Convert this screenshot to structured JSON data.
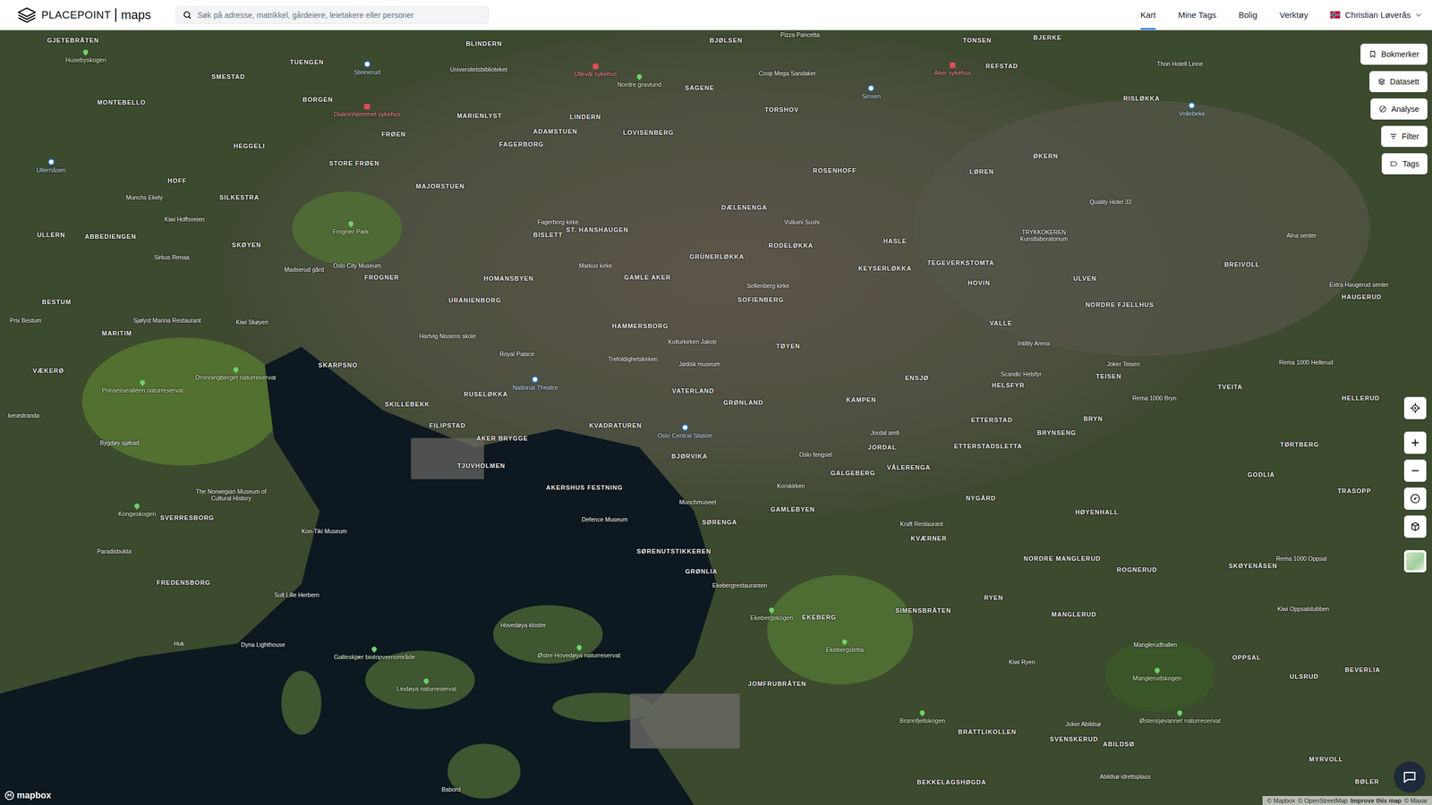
{
  "app": {
    "brand": "PLACEPOINT",
    "product": "maps"
  },
  "search": {
    "placeholder": "Søk på adresse, matrikkel, gårdeiere, leietakere eller personer"
  },
  "nav": [
    {
      "label": "Kart",
      "selected": true
    },
    {
      "label": "Mine Tags",
      "selected": false
    },
    {
      "label": "Bolig",
      "selected": false
    },
    {
      "label": "Verktøy",
      "selected": false
    }
  ],
  "user": {
    "name": "Christian Løverås"
  },
  "map_tools": [
    {
      "label": "Bokmerker"
    },
    {
      "label": "Datasett"
    },
    {
      "label": "Analyse"
    },
    {
      "label": "Filter"
    },
    {
      "label": "Tags"
    }
  ],
  "map": {
    "logo": "mapbox",
    "attribution": [
      {
        "text": "© Mapbox",
        "emphasis": false
      },
      {
        "text": "© OpenStreetMap",
        "emphasis": false
      },
      {
        "text": "Improve this map",
        "emphasis": true
      },
      {
        "text": "© Maxar",
        "emphasis": false
      }
    ],
    "labels": [
      {
        "text": "GJETEBRÅTEN",
        "kind": "area"
      },
      {
        "text": "BLINDERN",
        "kind": "area"
      },
      {
        "text": "Universitetsbiblioteket",
        "kind": "poi"
      },
      {
        "text": "BJØLSEN",
        "kind": "area"
      },
      {
        "text": "Pizza Pancetta",
        "kind": "poi"
      },
      {
        "text": "TONSEN",
        "kind": "area"
      },
      {
        "text": "BJERKE",
        "kind": "area"
      },
      {
        "text": "SMESTAD",
        "kind": "area"
      },
      {
        "text": "TUENGEN",
        "kind": "area"
      },
      {
        "text": "Steinerud",
        "kind": "station"
      },
      {
        "text": "Husebyskogen",
        "kind": "park"
      },
      {
        "text": "MONTEBELLO",
        "kind": "area"
      },
      {
        "text": "BORGEN",
        "kind": "area"
      },
      {
        "text": "Diakonhjemmet sykehus",
        "kind": "hospital"
      },
      {
        "text": "Ullevål sykehus",
        "kind": "hospital"
      },
      {
        "text": "Nordre gravlund",
        "kind": "park"
      },
      {
        "text": "SAGENE",
        "kind": "area"
      },
      {
        "text": "Coop Mega Sandaker",
        "kind": "poi"
      },
      {
        "text": "Aker sykehus",
        "kind": "hospital"
      },
      {
        "text": "REFSTAD",
        "kind": "area"
      },
      {
        "text": "Thon Hotell Linne",
        "kind": "poi"
      },
      {
        "text": "MARIENLYST",
        "kind": "area"
      },
      {
        "text": "ADAMSTUEN",
        "kind": "area"
      },
      {
        "text": "LINDERN",
        "kind": "area"
      },
      {
        "text": "LOVISENBERG",
        "kind": "area"
      },
      {
        "text": "TORSHOV",
        "kind": "area"
      },
      {
        "text": "Sinsen",
        "kind": "station"
      },
      {
        "text": "RISLØKKA",
        "kind": "area"
      },
      {
        "text": "Vollebekk",
        "kind": "station"
      },
      {
        "text": "FRØEN",
        "kind": "area"
      },
      {
        "text": "HEGGELI",
        "kind": "area"
      },
      {
        "text": "FAGERBORG",
        "kind": "area"
      },
      {
        "text": "STORE FRØEN",
        "kind": "area"
      },
      {
        "text": "Ullernåsen",
        "kind": "station"
      },
      {
        "text": "ROSENHOFF",
        "kind": "area"
      },
      {
        "text": "LØREN",
        "kind": "area"
      },
      {
        "text": "ØKERN",
        "kind": "area"
      },
      {
        "text": "HOFF",
        "kind": "area"
      },
      {
        "text": "MAJORSTUEN",
        "kind": "area"
      },
      {
        "text": "Munchs Ekely",
        "kind": "poi"
      },
      {
        "text": "SILKESTRA",
        "kind": "area"
      },
      {
        "text": "DÆLENENGA",
        "kind": "area"
      },
      {
        "text": "Quality Hotel 33",
        "kind": "poi"
      },
      {
        "text": "Kiwi Hoffsveien",
        "kind": "poi"
      },
      {
        "text": "Fagerborg kirke",
        "kind": "poi"
      },
      {
        "text": "Vulkani Sushi",
        "kind": "poi"
      },
      {
        "text": "Frogner Park",
        "kind": "park"
      },
      {
        "text": "ULLERN",
        "kind": "area"
      },
      {
        "text": "ABBEDIENGEN",
        "kind": "area"
      },
      {
        "text": "ST. HANSHAUGEN",
        "kind": "area"
      },
      {
        "text": "BISLETT",
        "kind": "area"
      },
      {
        "text": "HASLE",
        "kind": "area"
      },
      {
        "text": "TRYKKOKEREN Kunstlaboratorium",
        "kind": "poi"
      },
      {
        "text": "Alna senter",
        "kind": "poi"
      },
      {
        "text": "SKØYEN",
        "kind": "area"
      },
      {
        "text": "RODELØKKA",
        "kind": "area"
      },
      {
        "text": "GRÜNERLØKKA",
        "kind": "area"
      },
      {
        "text": "Sirkus Renaa",
        "kind": "poi"
      },
      {
        "text": "Oslo City Museum",
        "kind": "poi"
      },
      {
        "text": "Madserud gård",
        "kind": "poi"
      },
      {
        "text": "Markus kirke",
        "kind": "poi"
      },
      {
        "text": "KEYSERLØKKA",
        "kind": "area"
      },
      {
        "text": "TEGEVERKSTOMTA",
        "kind": "area"
      },
      {
        "text": "BREIVOLL",
        "kind": "area"
      },
      {
        "text": "FROGNER",
        "kind": "area"
      },
      {
        "text": "HOMANSBYEN",
        "kind": "area"
      },
      {
        "text": "GAMLE AKER",
        "kind": "area"
      },
      {
        "text": "ULVEN",
        "kind": "area"
      },
      {
        "text": "HOVIN",
        "kind": "area"
      },
      {
        "text": "Extra Haugerud senter",
        "kind": "poi"
      },
      {
        "text": "Sofienberg kirke",
        "kind": "poi"
      },
      {
        "text": "SOFIENBERG",
        "kind": "area"
      },
      {
        "text": "URANIENBORG",
        "kind": "area"
      },
      {
        "text": "HAUGERUD",
        "kind": "area"
      },
      {
        "text": "BESTUM",
        "kind": "area"
      },
      {
        "text": "NORDRE FJELLHUS",
        "kind": "area"
      },
      {
        "text": "Prix Bestum",
        "kind": "poi"
      },
      {
        "text": "Sjølyst Marina Restaurant",
        "kind": "poi"
      },
      {
        "text": "Kiwi Skøyen",
        "kind": "poi"
      },
      {
        "text": "HAMMERSBORG",
        "kind": "area"
      },
      {
        "text": "VALLE",
        "kind": "area"
      },
      {
        "text": "MARITIM",
        "kind": "area"
      },
      {
        "text": "Hartvig Nissens skole",
        "kind": "poi"
      },
      {
        "text": "Kulturkirken Jakob",
        "kind": "poi"
      },
      {
        "text": "TØYEN",
        "kind": "area"
      },
      {
        "text": "Intility Arena",
        "kind": "poi"
      },
      {
        "text": "Royal Palace",
        "kind": "poi"
      },
      {
        "text": "Trefoldighetskirken",
        "kind": "poi"
      },
      {
        "text": "Jødisk museum",
        "kind": "poi"
      },
      {
        "text": "Rema 1000 Hellerud",
        "kind": "poi"
      },
      {
        "text": "Joker Teisen",
        "kind": "poi"
      },
      {
        "text": "SKARPSNO",
        "kind": "area"
      },
      {
        "text": "VÆKERØ",
        "kind": "area"
      },
      {
        "text": "Dronningberget naturreservat",
        "kind": "park"
      },
      {
        "text": "Scandic Helsfyr",
        "kind": "poi"
      },
      {
        "text": "TEISEN",
        "kind": "area"
      },
      {
        "text": "ENSJØ",
        "kind": "area"
      },
      {
        "text": "Prinsessealléen naturreservat",
        "kind": "park"
      },
      {
        "text": "National Theatre",
        "kind": "station"
      },
      {
        "text": "HELSFYR",
        "kind": "area"
      },
      {
        "text": "TVEITA",
        "kind": "area"
      },
      {
        "text": "VATERLAND",
        "kind": "area"
      },
      {
        "text": "RUSELØKKA",
        "kind": "area"
      },
      {
        "text": "Rema 1000 Bryn",
        "kind": "poi"
      },
      {
        "text": "HELLERUD",
        "kind": "area"
      },
      {
        "text": "KAMPEN",
        "kind": "area"
      },
      {
        "text": "GRØNLAND",
        "kind": "area"
      },
      {
        "text": "SKILLEBEKK",
        "kind": "area"
      },
      {
        "text": "kerøstranda",
        "kind": "poi"
      },
      {
        "text": "BRYN",
        "kind": "area"
      },
      {
        "text": "ETTERSTAD",
        "kind": "area"
      },
      {
        "text": "FILIPSTAD",
        "kind": "area"
      },
      {
        "text": "KVADRATUREN",
        "kind": "area"
      },
      {
        "text": "Oslo Central Station",
        "kind": "station"
      },
      {
        "text": "Jordal amfi",
        "kind": "poi"
      },
      {
        "text": "BRYNSENG",
        "kind": "area"
      },
      {
        "text": "AKER BRYGGE",
        "kind": "area"
      },
      {
        "text": "Bygdøy sjøbad",
        "kind": "poi"
      },
      {
        "text": "TØRTBERG",
        "kind": "area"
      },
      {
        "text": "ETTERSTADSLETTA",
        "kind": "area"
      },
      {
        "text": "JORDAL",
        "kind": "area"
      },
      {
        "text": "Oslo fengsel",
        "kind": "poi"
      },
      {
        "text": "BJØRVIKA",
        "kind": "area"
      },
      {
        "text": "TJUVHOLMEN",
        "kind": "area"
      },
      {
        "text": "VÅLERENGA",
        "kind": "area"
      },
      {
        "text": "GALGEBERG",
        "kind": "area"
      },
      {
        "text": "GODLIA",
        "kind": "area"
      },
      {
        "text": "Korskirken",
        "kind": "poi"
      },
      {
        "text": "AKERSHUS FESTNING",
        "kind": "area"
      },
      {
        "text": "TRASOPP",
        "kind": "area"
      },
      {
        "text": "The Norwegian Museum of Cultural History",
        "kind": "poi"
      },
      {
        "text": "NYGÅRD",
        "kind": "area"
      },
      {
        "text": "Munchmuseet",
        "kind": "poi"
      },
      {
        "text": "GAMLEBYEN",
        "kind": "area"
      },
      {
        "text": "Kongeskogen",
        "kind": "park"
      },
      {
        "text": "HØYENHALL",
        "kind": "area"
      },
      {
        "text": "SVERRESBORG",
        "kind": "area"
      },
      {
        "text": "Defence Museum",
        "kind": "poi"
      },
      {
        "text": "SØRENGA",
        "kind": "area"
      },
      {
        "text": "Kraft Restaurant",
        "kind": "poi"
      },
      {
        "text": "Kon-Tiki Museum",
        "kind": "poi"
      },
      {
        "text": "KVÆRNER",
        "kind": "area"
      },
      {
        "text": "Paradisbukta",
        "kind": "poi"
      },
      {
        "text": "SØRENUTSTIKKEREN",
        "kind": "area"
      },
      {
        "text": "NORDRE MANGLERUD",
        "kind": "area"
      },
      {
        "text": "Rema 1000 Oppsal",
        "kind": "poi"
      },
      {
        "text": "SKØYENÅSEN",
        "kind": "area"
      },
      {
        "text": "ROGNERUD",
        "kind": "area"
      },
      {
        "text": "GRØNLIA",
        "kind": "area"
      },
      {
        "text": "FREDENSBORG",
        "kind": "area"
      },
      {
        "text": "Ekebergrestauranten",
        "kind": "poi"
      },
      {
        "text": "Sult Lille Herbern",
        "kind": "poi"
      },
      {
        "text": "RYEN",
        "kind": "area"
      },
      {
        "text": "SIMENSBRÅTEN",
        "kind": "area"
      },
      {
        "text": "Kiwi Oppsalstubben",
        "kind": "poi"
      },
      {
        "text": "Ekebergskogen",
        "kind": "park"
      },
      {
        "text": "MANGLERUD",
        "kind": "area"
      },
      {
        "text": "EKEBERG",
        "kind": "area"
      },
      {
        "text": "Hovedøya kloster",
        "kind": "poi"
      },
      {
        "text": "Huk",
        "kind": "poi"
      },
      {
        "text": "Dyna Lighthouse",
        "kind": "poi"
      },
      {
        "text": "Manglerudhallen",
        "kind": "poi"
      },
      {
        "text": "Ekebergsletta",
        "kind": "park"
      },
      {
        "text": "Østre Hovedøya naturreservat",
        "kind": "park"
      },
      {
        "text": "Galteskjær biotopvernområde",
        "kind": "park"
      },
      {
        "text": "OPPSAL",
        "kind": "area"
      },
      {
        "text": "Kiwi Ryen",
        "kind": "poi"
      },
      {
        "text": "BEVERLIA",
        "kind": "area"
      },
      {
        "text": "Manglerudskogen",
        "kind": "park"
      },
      {
        "text": "ULSRUD",
        "kind": "area"
      },
      {
        "text": "JOMFRUBRÅTEN",
        "kind": "area"
      },
      {
        "text": "Lindøya naturreservat",
        "kind": "park"
      },
      {
        "text": "Brannfjellskogen",
        "kind": "park"
      },
      {
        "text": "Østensjøvannet naturreservat",
        "kind": "park"
      },
      {
        "text": "Joker Abildsø",
        "kind": "poi"
      },
      {
        "text": "BRATTLIKOLLEN",
        "kind": "area"
      },
      {
        "text": "SVENSKERUD",
        "kind": "area"
      },
      {
        "text": "ABILDSØ",
        "kind": "area"
      },
      {
        "text": "MYRVOLL",
        "kind": "area"
      },
      {
        "text": "Abildsø idrettsplass",
        "kind": "poi"
      },
      {
        "text": "BEKKELAGSHØGDA",
        "kind": "area"
      },
      {
        "text": "BØLER",
        "kind": "area"
      },
      {
        "text": "Babord",
        "kind": "poi"
      }
    ]
  }
}
